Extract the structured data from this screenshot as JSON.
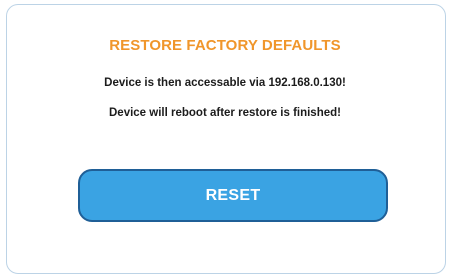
{
  "panel": {
    "title": "RESTORE FACTORY DEFAULTS",
    "messages": [
      "Device is then accessable via 192.168.0.130!",
      "Device will reboot after restore is finished!"
    ]
  },
  "actions": {
    "reset_label": "RESET"
  },
  "colors": {
    "title": "#f0962b",
    "button_fill": "#3aa3e3",
    "button_border": "#1f5f97",
    "frame_border": "#bcd3e6"
  }
}
